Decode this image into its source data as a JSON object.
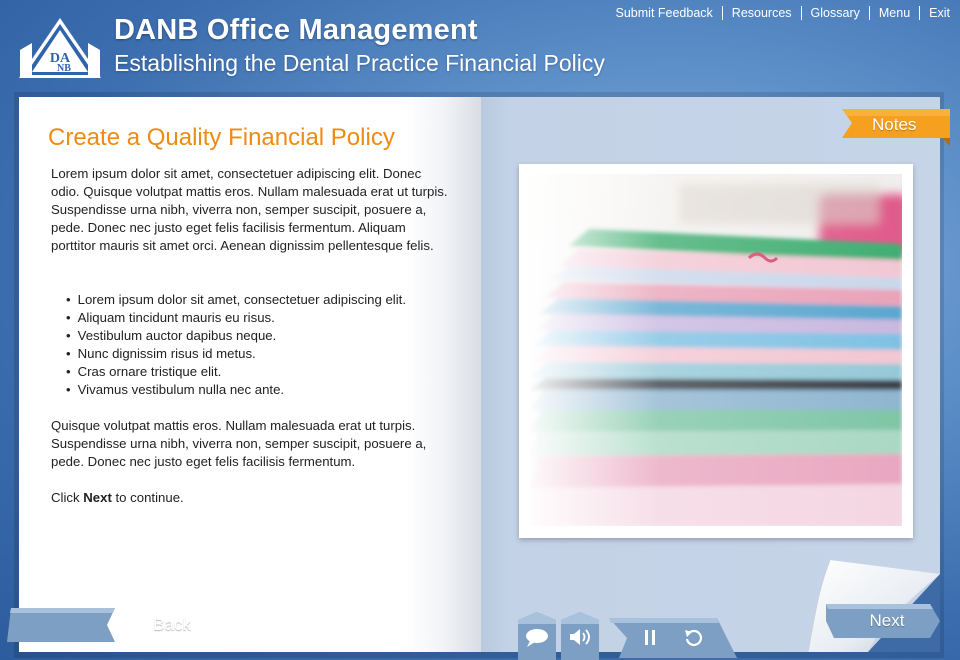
{
  "header": {
    "logo_text": "DANB",
    "title": "DANB Office Management",
    "subtitle": "Establishing the Dental Practice Financial Policy"
  },
  "topnav": {
    "items": [
      "Submit Feedback",
      "Resources",
      "Glossary",
      "Menu",
      "Exit"
    ]
  },
  "content": {
    "heading": "Create a Quality Financial Policy",
    "paragraph1": "Lorem ipsum dolor sit amet, consectetuer adipiscing elit. Donec odio. Quisque volutpat mattis eros. Nullam malesuada erat ut turpis. Suspendisse urna nibh, viverra non, semper suscipit, posuere a, pede. Donec nec justo eget felis facilisis fermentum. Aliquam porttitor mauris sit amet orci. Aenean dignissim pellentesque felis.",
    "bullets": [
      "Lorem ipsum dolor sit amet, consectetuer adipiscing elit.",
      "Aliquam tincidunt mauris eu risus.",
      "Vestibulum auctor dapibus neque.",
      "Nunc dignissim risus id metus.",
      "Cras ornare tristique elit.",
      "Vivamus vestibulum nulla nec ante."
    ],
    "paragraph2": "Quisque volutpat mattis eros. Nullam malesuada erat ut turpis. Suspendisse urna nibh, viverra non, semper suscipit, posuere a, pede. Donec nec justo eget felis facilisis fermentum.",
    "click_prefix": "Click ",
    "click_bold": "Next",
    "click_suffix": " to continue."
  },
  "notes": {
    "label": "Notes"
  },
  "navigation": {
    "back_label": "Back",
    "next_label": "Next"
  },
  "controls": {
    "icons": [
      "speech-bubble-icon",
      "speaker-icon",
      "pause-icon",
      "replay-icon"
    ]
  },
  "colors": {
    "heading_accent": "#ef8a13",
    "notes_tab": "#f5a01e",
    "button_steel": "#7d9fc4",
    "background_blue": "#3a6cae"
  }
}
